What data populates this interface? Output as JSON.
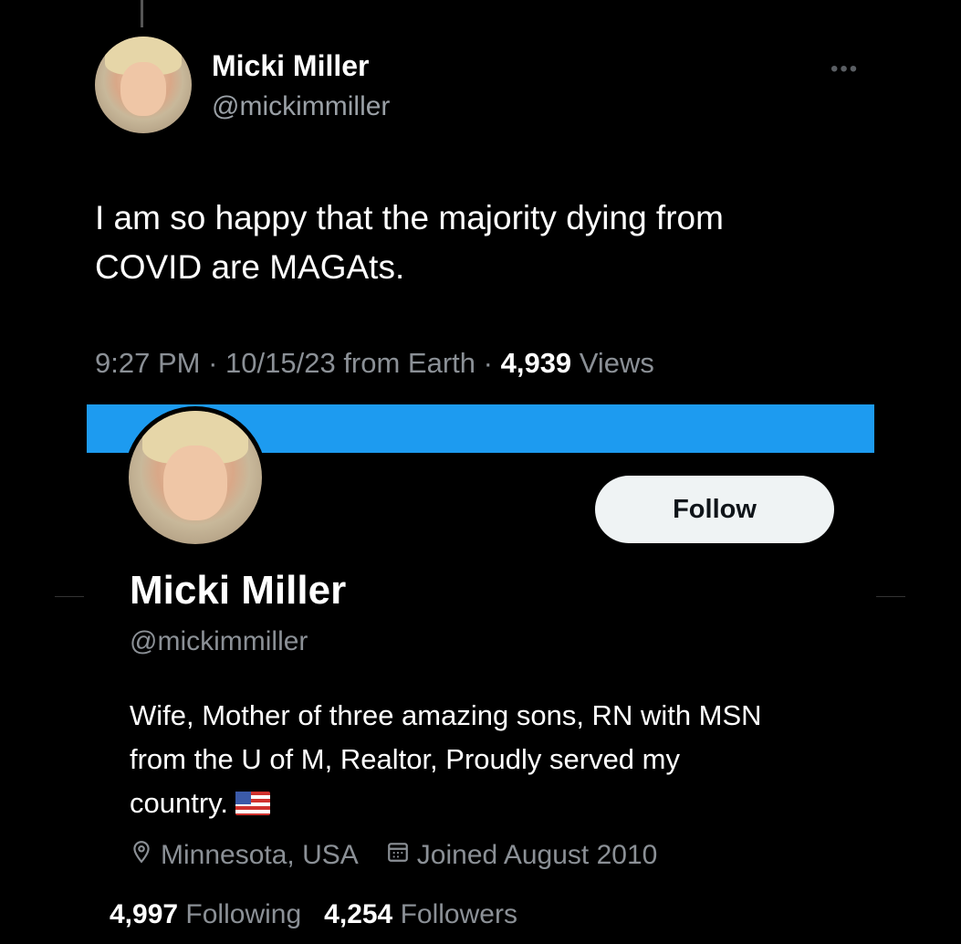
{
  "tweet": {
    "author_name": "Micki Miller",
    "author_handle": "@mickimmiller",
    "more_icon": "more-icon",
    "text_line1": "I am so happy that the majority dying from",
    "text_line2": "COVID are MAGAts.",
    "time": "9:27 PM",
    "date": "10/15/23",
    "source": "from Earth",
    "views_count": "4,939",
    "views_label": "Views"
  },
  "profile": {
    "banner_color": "#1d9bf0",
    "follow_label": "Follow",
    "name": "Micki Miller",
    "handle": "@mickimmiller",
    "bio_line1": "Wife, Mother of three amazing sons, RN with MSN",
    "bio_line2": "from the U of M, Realtor, Proudly served my",
    "bio_line3": "country.",
    "location": "Minnesota, USA",
    "joined": "Joined August 2010",
    "following_count": "4,997",
    "following_label": "Following",
    "followers_count": "4,254",
    "followers_label": "Followers"
  }
}
